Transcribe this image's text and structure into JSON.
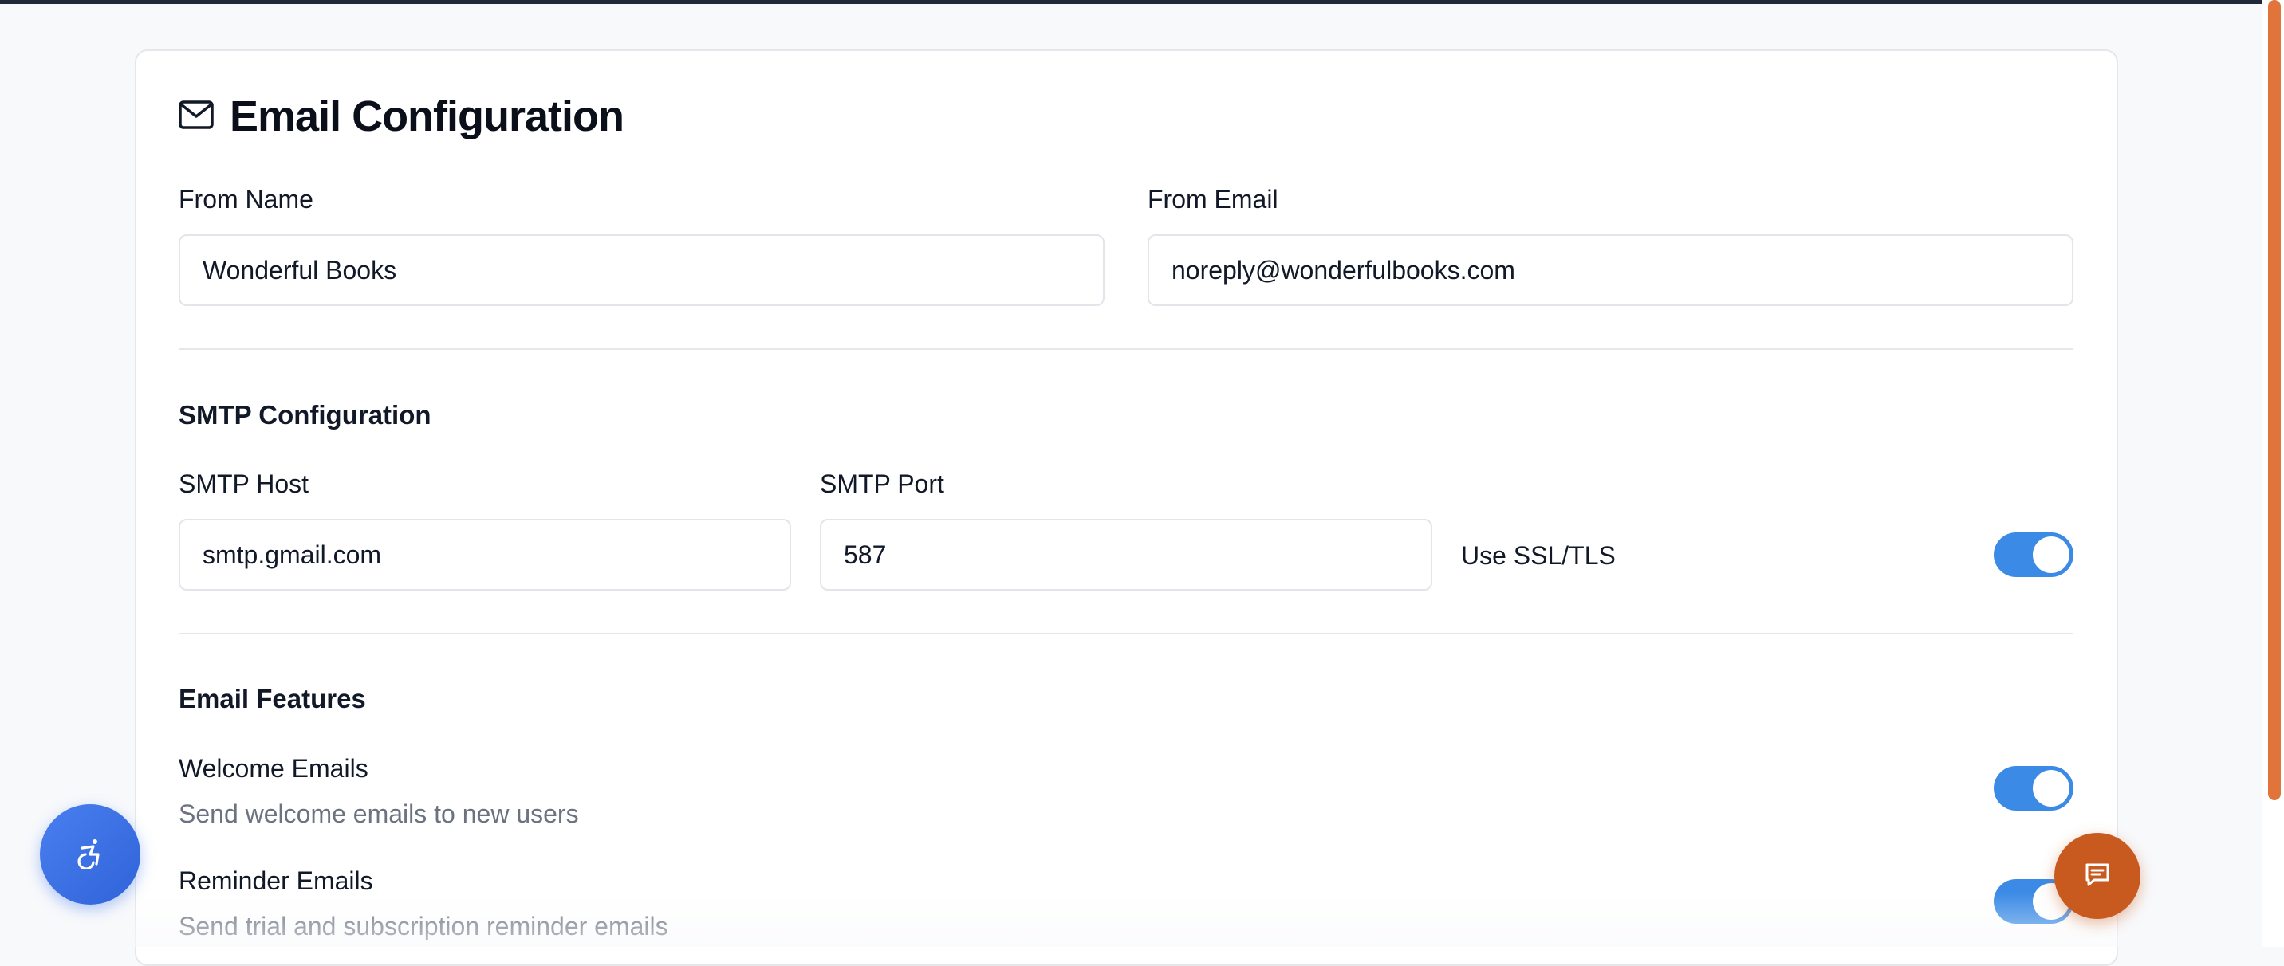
{
  "page": {
    "title": "Email Configuration"
  },
  "sender": {
    "from_name_label": "From Name",
    "from_name_value": "Wonderful Books",
    "from_email_label": "From Email",
    "from_email_value": "noreply@wonderfulbooks.com"
  },
  "smtp": {
    "section_title": "SMTP Configuration",
    "host_label": "SMTP Host",
    "host_value": "smtp.gmail.com",
    "port_label": "SMTP Port",
    "port_value": "587",
    "ssl_label": "Use SSL/TLS",
    "ssl_enabled": true
  },
  "features": {
    "section_title": "Email Features",
    "items": [
      {
        "title": "Welcome Emails",
        "description": "Send welcome emails to new users",
        "enabled": true
      },
      {
        "title": "Reminder Emails",
        "description": "Send trial and subscription reminder emails",
        "enabled": true
      }
    ]
  },
  "icons": {
    "title_icon": "mail-icon",
    "accessibility_button": "accessibility-icon",
    "chat_button": "chat-icon"
  },
  "colors": {
    "toggle_on": "#3b8be6",
    "accessibility_fab": "#3b6fe6",
    "chat_fab": "#c95a1f",
    "scrollbar_thumb": "#e0743a"
  }
}
